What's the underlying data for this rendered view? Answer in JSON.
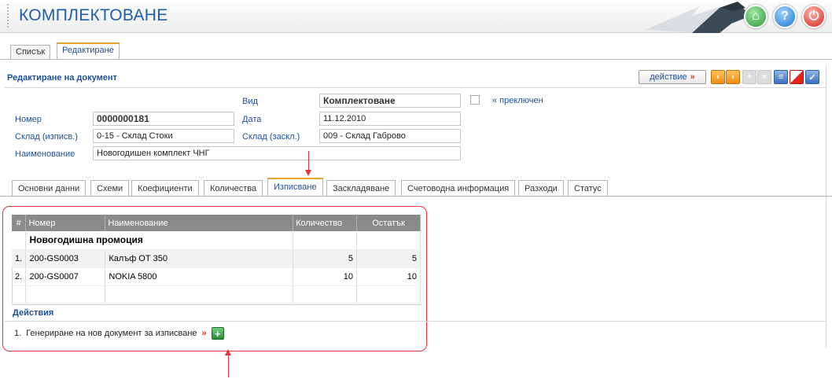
{
  "header": {
    "title": "КОМПЛЕКТОВАНЕ",
    "buttons": [
      "home-icon",
      "help-icon",
      "power-icon"
    ]
  },
  "top_tabs": [
    {
      "label": "Списък",
      "active": false
    },
    {
      "label": "Редактиране",
      "active": true
    }
  ],
  "panel": {
    "title": "Редактиране на документ",
    "action_label": "действие",
    "action_arrow": "»"
  },
  "form": {
    "vid_label": "Вид",
    "vid_value": "Комплектоване",
    "switched_label": "« преключен",
    "number_label": "Номер",
    "number_value": "0000000181",
    "date_label": "Дата",
    "date_value": "11.12.2010",
    "warehouse_out_label": "Склад (изписв.)",
    "warehouse_out_value": "0-15 - Склад Стоки",
    "warehouse_in_label": "Склад (заскл.)",
    "warehouse_in_value": "009 - Склад Габрово",
    "name_label": "Наименование",
    "name_value": "Новогодишен комплект ЧНГ"
  },
  "sub_tabs": [
    "Основни данни",
    "Схеми",
    "Коефициенти",
    "Количества",
    "Изписване",
    "Заскладяване",
    "Счетоводна информация",
    "Разходи",
    "Статус"
  ],
  "active_sub_tab": "Изписване",
  "table": {
    "columns": [
      "#",
      "Номер",
      "Наименование",
      "Количество",
      "Остатък"
    ],
    "group": "Новогодишна промоция",
    "rows": [
      {
        "idx": "1.",
        "number": "200-GS0003",
        "name": "Калъф ОТ 350",
        "qty": "5",
        "rest": "5"
      },
      {
        "idx": "2.",
        "number": "200-GS0007",
        "name": "NOKIA 5800",
        "qty": "10",
        "rest": "10"
      }
    ]
  },
  "actions": {
    "title": "Действия",
    "items": [
      {
        "idx": "1.",
        "label": "Генериране на нов документ за изписване",
        "arrow": "»"
      }
    ]
  },
  "colors": {
    "accent_blue": "#1c4f99",
    "tab_orange": "#e7a22b",
    "highlight_red": "#e0343b"
  }
}
